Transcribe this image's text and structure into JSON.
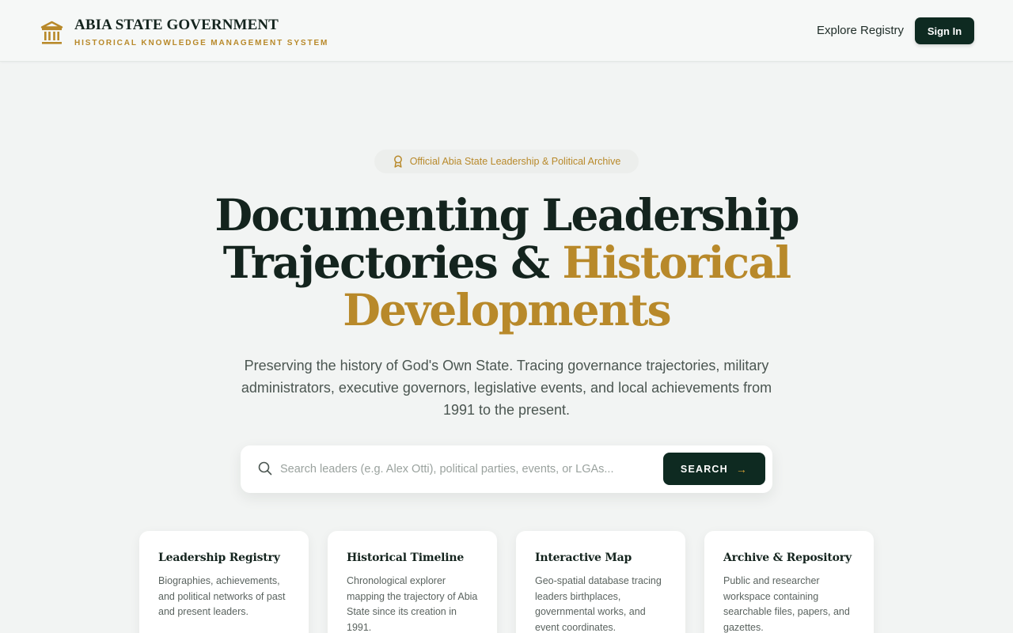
{
  "header": {
    "title": "ABIA STATE GOVERNMENT",
    "subtitle": "HISTORICAL KNOWLEDGE MANAGEMENT SYSTEM",
    "logo_icon": "government-building-icon",
    "nav_link": "Explore Registry",
    "signin_label": "Sign In"
  },
  "hero": {
    "badge_icon": "award-ribbon-icon",
    "badge": "Official Abia State Leadership & Political Archive",
    "headline_line1": "Documenting Leadership",
    "headline_line2_dark": "Trajectories & ",
    "headline_line2_gold": "Historical",
    "headline_line3_gold": "Developments",
    "description": "Preserving the history of God's Own State. Tracing governance trajectories, military administrators, executive governors, legislative events, and local achievements from 1991 to the present."
  },
  "search": {
    "icon": "search-icon",
    "placeholder": "Search leaders (e.g. Alex Otti), political parties, events, or LGAs...",
    "value": "",
    "button_label": "SEARCH",
    "button_icon": "arrow-right-icon"
  },
  "cards": [
    {
      "title": "Leadership Registry",
      "description": "Biographies, achievements, and political networks of past and present leaders."
    },
    {
      "title": "Historical Timeline",
      "description": "Chronological explorer mapping the trajectory of Abia State since its creation in 1991."
    },
    {
      "title": "Interactive Map",
      "description": "Geo-spatial database tracing leaders birthplaces, governmental works, and event coordinates."
    },
    {
      "title": "Archive & Repository",
      "description": "Public and researcher workspace containing searchable files, papers, and gazettes."
    }
  ],
  "colors": {
    "primary_dark": "#0e2a21",
    "accent_gold": "#b8892a",
    "background": "#f2f4f3"
  }
}
